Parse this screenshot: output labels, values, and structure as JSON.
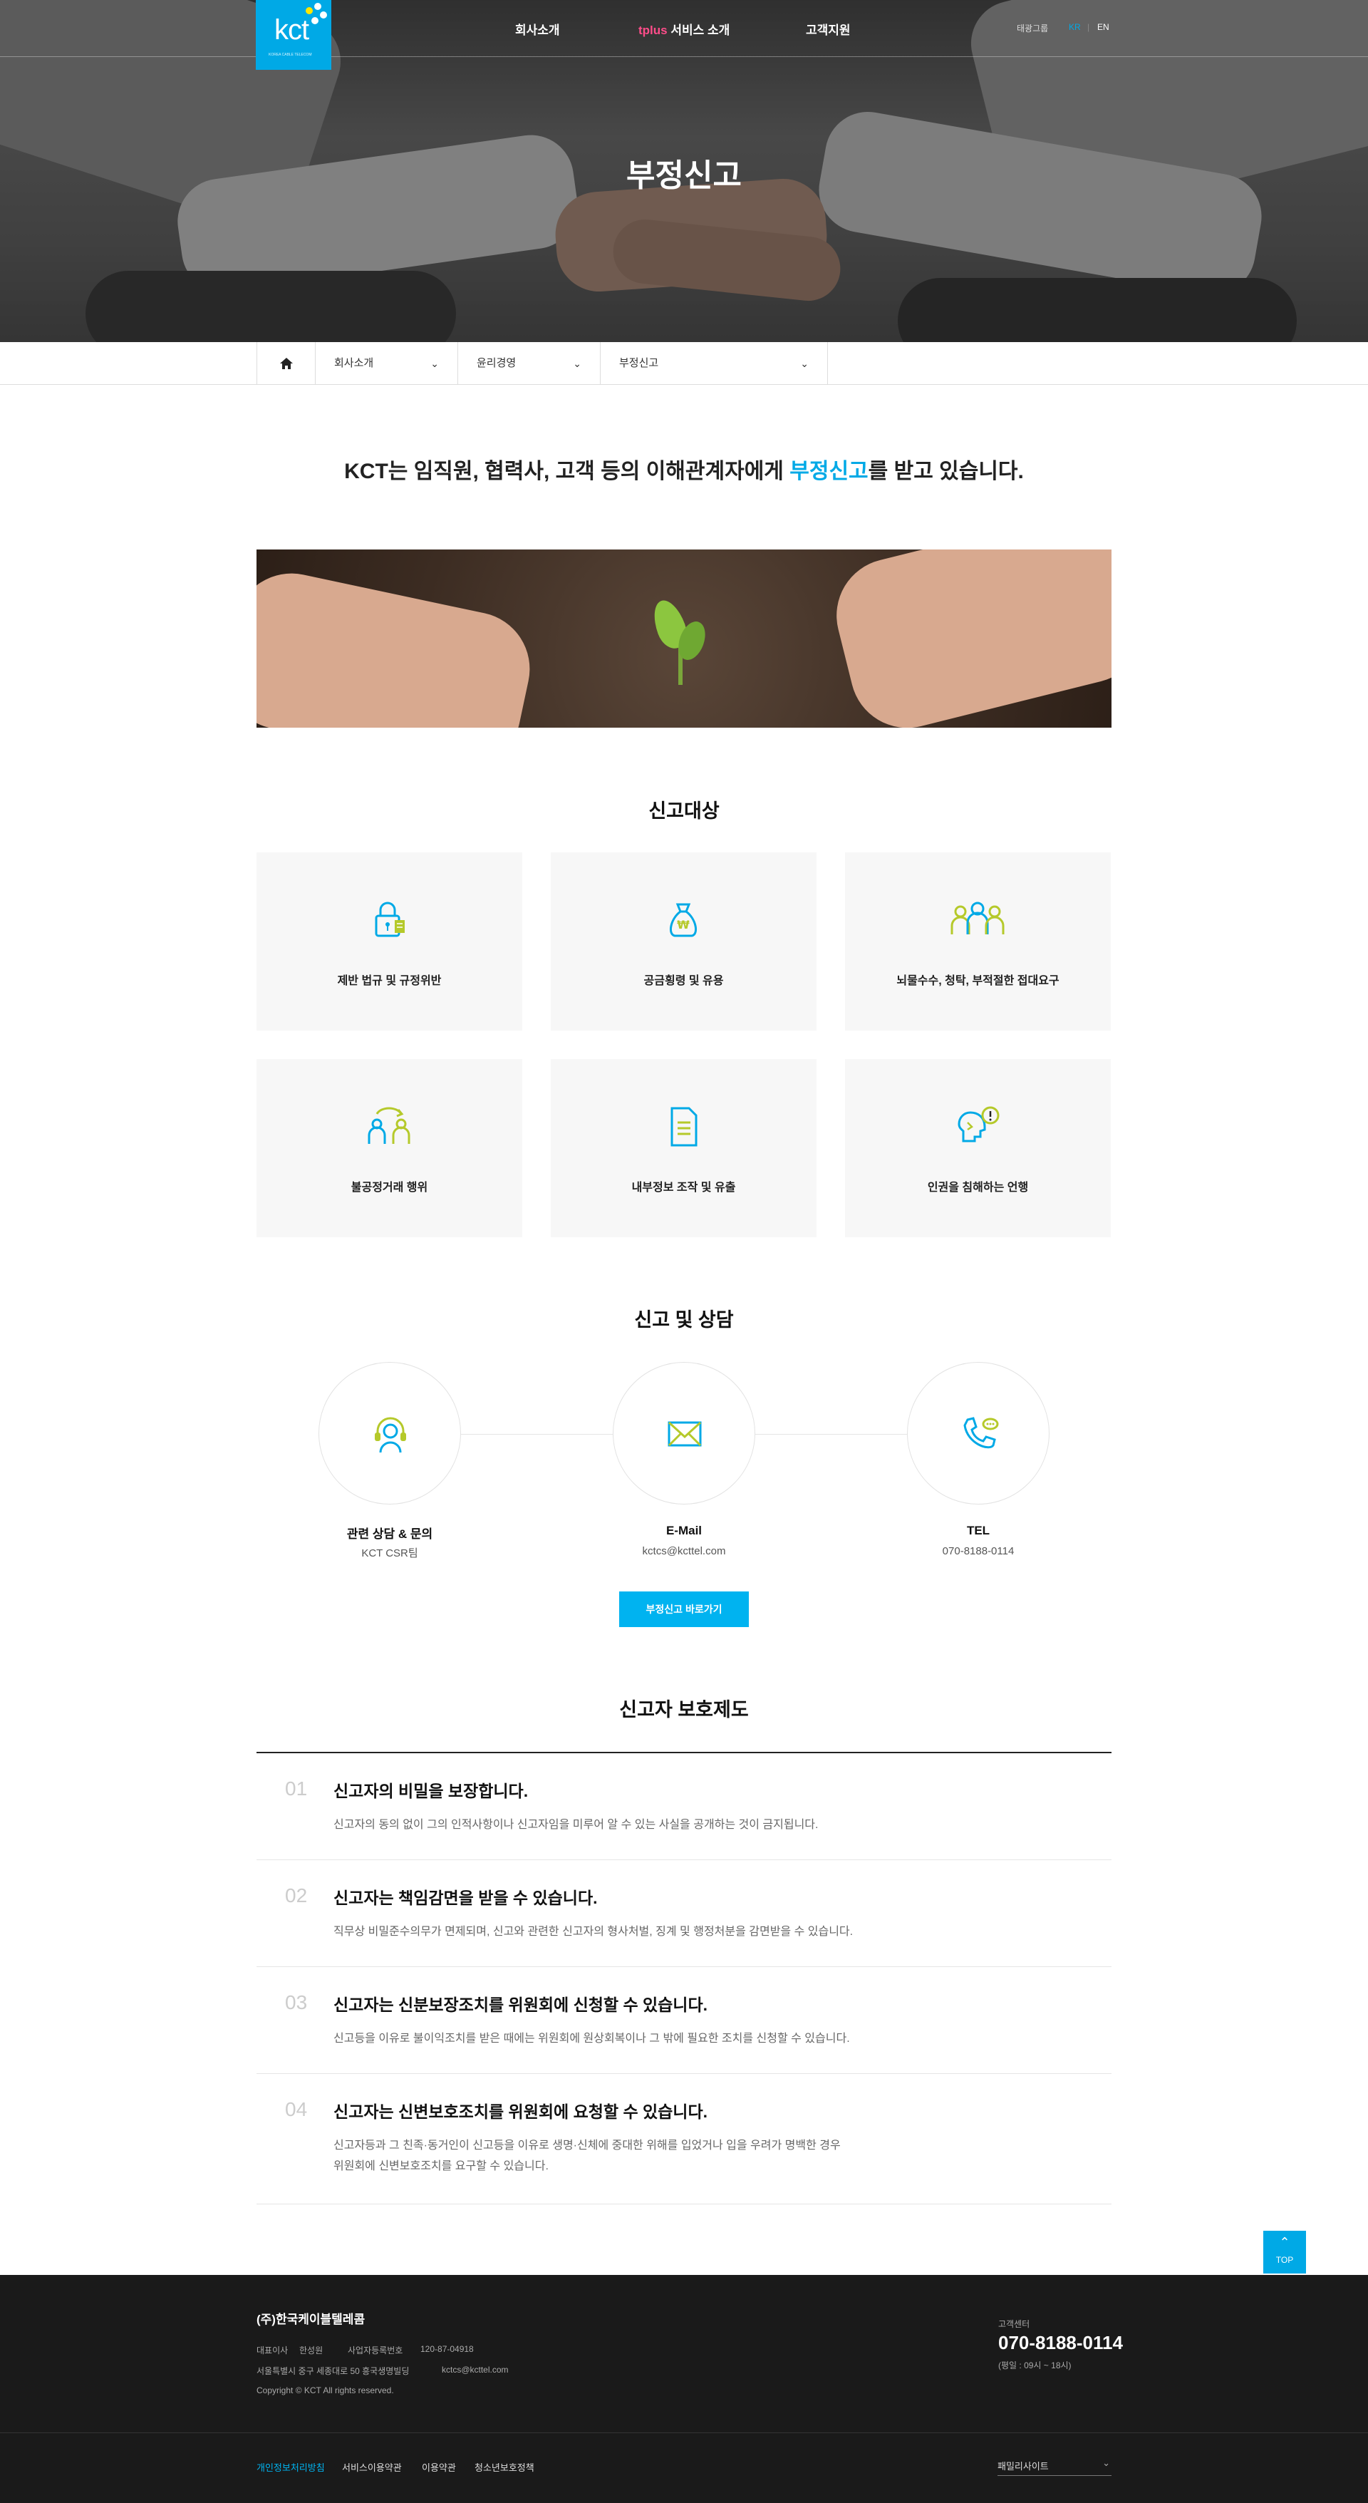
{
  "header": {
    "logo_text": "kct",
    "logo_sub": "KOREA CABLE TELECOM",
    "nav": [
      {
        "label": "회사소개"
      },
      {
        "prefix": "tplus",
        "label": "서비스 소개"
      },
      {
        "label": "고객지원"
      }
    ],
    "util_group": "태광그룹",
    "lang_kr": "KR",
    "lang_sep": "|",
    "lang_en": "EN",
    "hero_title": "부정신고"
  },
  "breadcrumb": {
    "home_icon": "home-icon",
    "items": [
      "회사소개",
      "윤리경영",
      "부정신고"
    ]
  },
  "intro": {
    "before": "KCT는 임직원, 협력사, 고객 등의 이해관계자에게 ",
    "highlight": "부정신고",
    "after": "를 받고 있습니다."
  },
  "targets": {
    "title": "신고대상",
    "items": [
      {
        "label": "제반 법규 및 규정위반",
        "icon": "lock-document-icon"
      },
      {
        "label": "공금횡령 및 유용",
        "icon": "money-bag-icon"
      },
      {
        "label": "뇌물수수, 청탁, 부적절한 접대요구",
        "icon": "people-group-icon"
      },
      {
        "label": "불공정거래 행위",
        "icon": "people-exchange-icon"
      },
      {
        "label": "내부정보 조작 및 유출",
        "icon": "document-icon"
      },
      {
        "label": "인권을 침해하는 언행",
        "icon": "head-alert-icon"
      }
    ]
  },
  "contact": {
    "title": "신고 및 상담",
    "items": [
      {
        "title": "관련 상담 & 문의",
        "value": "KCT CSR팀",
        "icon": "headset-icon"
      },
      {
        "title": "E-Mail",
        "value": "kctcs@kcttel.com",
        "icon": "mail-icon"
      },
      {
        "title": "TEL",
        "value": "070-8188-0114",
        "icon": "phone-icon"
      }
    ],
    "button": "부정신고 바로가기"
  },
  "protection": {
    "title": "신고자 보호제도",
    "items": [
      {
        "num": "01",
        "heading": "신고자의 비밀을 보장합니다.",
        "desc": [
          "신고자의 동의 없이 그의 인적사항이나 신고자임을 미루어 알 수 있는 사실을 공개하는 것이 금지됩니다."
        ]
      },
      {
        "num": "02",
        "heading": "신고자는 책임감면을 받을 수 있습니다.",
        "desc": [
          "직무상 비밀준수의무가 면제되며, 신고와 관련한 신고자의 형사처벌, 징계 및 행정처분을 감면받을 수 있습니다."
        ]
      },
      {
        "num": "03",
        "heading": "신고자는 신분보장조치를 위원회에 신청할 수 있습니다.",
        "desc": [
          "신고등을 이유로 불이익조치를 받은 때에는 위원회에 원상회복이나 그 밖에 필요한 조치를 신청할 수 있습니다."
        ]
      },
      {
        "num": "04",
        "heading": "신고자는 신변보호조치를 위원회에 요청할 수 있습니다.",
        "desc": [
          "신고자등과 그 친족·동거인이 신고등을 이유로 생명·신체에 중대한 위해를 입었거나 입을 우려가 명백한 경우",
          "위원회에 신변보호조치를 요구할 수 있습니다."
        ]
      }
    ]
  },
  "top_button": "TOP",
  "footer": {
    "company": "(주)한국케이블텔레콤",
    "ceo_label": "대표이사",
    "ceo": "한성원",
    "bizno_label": "사업자등록번호",
    "bizno": "120-87-04918",
    "address": "서울특별시 중구 세종대로 50 흥국생명빌딩",
    "email": "kctcs@kcttel.com",
    "copyright": "Copyright © KCT All rights reserved.",
    "cs_label": "고객센터",
    "cs_phone": "070-8188-0114",
    "cs_hours": "(평일 : 09시 ~ 18시)",
    "links": [
      "개인정보처리방침",
      "서비스이용약관",
      "이용약관",
      "청소년보호정책"
    ],
    "family_site": "패밀리사이트"
  },
  "colors": {
    "accent": "#00a9e6",
    "icon_lime": "#b5c92a",
    "footer_bg": "#1a1a1a",
    "pink": "#ff4d8a"
  }
}
